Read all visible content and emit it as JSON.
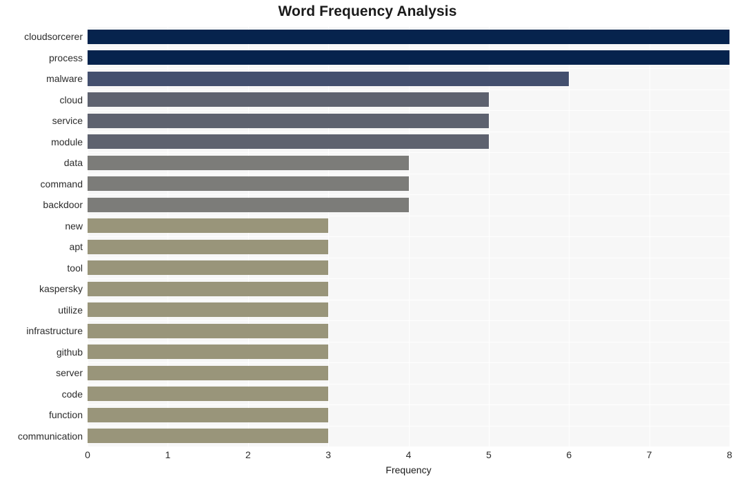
{
  "chart_data": {
    "type": "bar",
    "orientation": "horizontal",
    "title": "Word Frequency Analysis",
    "xlabel": "Frequency",
    "ylabel": "",
    "categories": [
      "cloudsorcerer",
      "process",
      "malware",
      "cloud",
      "service",
      "module",
      "data",
      "command",
      "backdoor",
      "new",
      "apt",
      "tool",
      "kaspersky",
      "utilize",
      "infrastructure",
      "github",
      "server",
      "code",
      "function",
      "communication"
    ],
    "values": [
      8,
      8,
      6,
      5,
      5,
      5,
      4,
      4,
      4,
      3,
      3,
      3,
      3,
      3,
      3,
      3,
      3,
      3,
      3,
      3
    ],
    "bar_colors": [
      "#06234d",
      "#06234d",
      "#434f6e",
      "#5e626f",
      "#5e626f",
      "#5e626f",
      "#7c7c79",
      "#7c7c79",
      "#7c7c79",
      "#99957a",
      "#99957a",
      "#99957a",
      "#99957a",
      "#99957a",
      "#99957a",
      "#99957a",
      "#99957a",
      "#99957a",
      "#99957a",
      "#99957a"
    ],
    "xlim": [
      0,
      8
    ],
    "xticks": [
      0,
      1,
      2,
      3,
      4,
      5,
      6,
      7,
      8
    ],
    "xtick_labels": [
      "0",
      "1",
      "2",
      "3",
      "4",
      "5",
      "6",
      "7",
      "8"
    ],
    "grid": true,
    "grid_color": "#ffffff",
    "plot_background": "#f7f7f7",
    "figure_background": "#ffffff",
    "legend": null
  }
}
